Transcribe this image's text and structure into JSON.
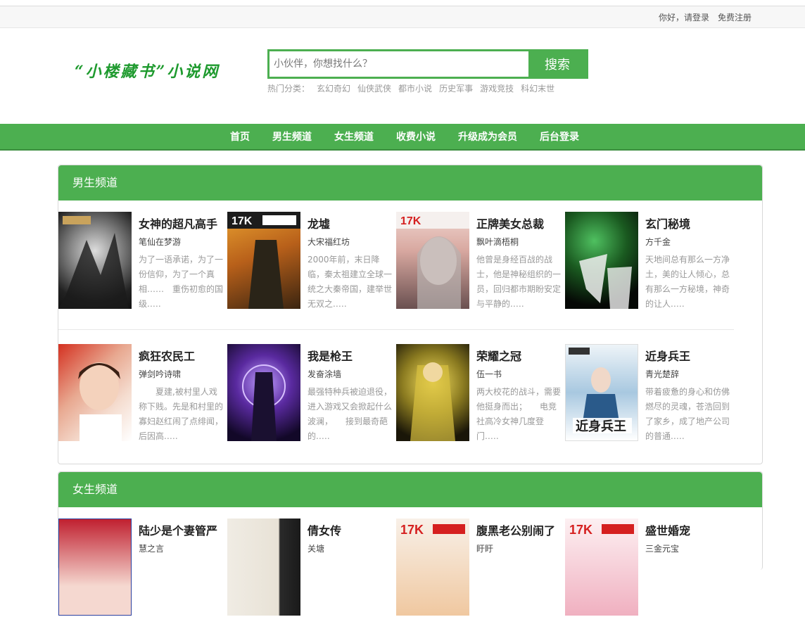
{
  "topbar": {
    "greeting": "你好，",
    "login": "请登录",
    "register": "免费注册"
  },
  "logo": {
    "text": "“小楼藏书”小说网"
  },
  "search": {
    "placeholder": "小伙伴，你想找什么？",
    "button": "搜索"
  },
  "hot": {
    "label": "热门分类：",
    "cats": [
      "玄幻奇幻",
      "仙侠武侠",
      "都市小说",
      "历史军事",
      "游戏竞技",
      "科幻末世"
    ]
  },
  "nav": [
    "首页",
    "男生频道",
    "女生频道",
    "收费小说",
    "升级成为会员",
    "后台登录"
  ],
  "male": {
    "title": "男生频道",
    "books": [
      {
        "title": "女神的超凡高手",
        "author": "笔仙在梦游",
        "desc": "为了一语承诺，为了一份信仰，为了一个真相……　重伤初愈的国级.…."
      },
      {
        "title": "龙墟",
        "author": "大宋福红坊",
        "desc": "2000年前，末日降临，秦太祖建立全球一统之大秦帝国，建举世无双之.…."
      },
      {
        "title": "正牌美女总裁",
        "author": "飘叶滴梧桐",
        "desc": "他曾是身经百战的战士，他是神秘组织的一员，回归都市期盼安定与平静的.…."
      },
      {
        "title": "玄门秘境",
        "author": "方千金",
        "desc": "天地间总有那么一方净土，美的让人倾心，总有那么一方秘境，神奇的让人.…."
      },
      {
        "title": "疯狂农民工",
        "author": "弹剑吟诗啸",
        "desc": "　　夏建,被村里人戏称下贱。先是和村里的寡妇赵红闹了点绯闻，后因高.…."
      },
      {
        "title": "我是枪王",
        "author": "发奋涂墙",
        "desc": "最强特种兵被迫退役，进入游戏又会掀起什么波澜，　　接到最奇葩的.…."
      },
      {
        "title": "荣耀之冠",
        "author": "伍一书",
        "desc": "两大校花的战斗，需要他挺身而出；　　电竞社高冷女神几度登门.…."
      },
      {
        "title": "近身兵王",
        "author": "青光楚辞",
        "desc": "带着疲惫的身心和仿佛燃尽的灵魂，苍浩回到了家乡，成了地产公司的普通.…."
      }
    ]
  },
  "female": {
    "title": "女生频道",
    "books": [
      {
        "title": "陆少是个妻管严",
        "author": "慧之言"
      },
      {
        "title": "倩女传",
        "author": "关塘"
      },
      {
        "title": "腹黑老公别闹了",
        "author": "盱盱"
      },
      {
        "title": "盛世婚宠",
        "author": "三金元宝"
      }
    ]
  },
  "colors": {
    "accent": "#4caf50",
    "logo": "#1e9a2e"
  }
}
